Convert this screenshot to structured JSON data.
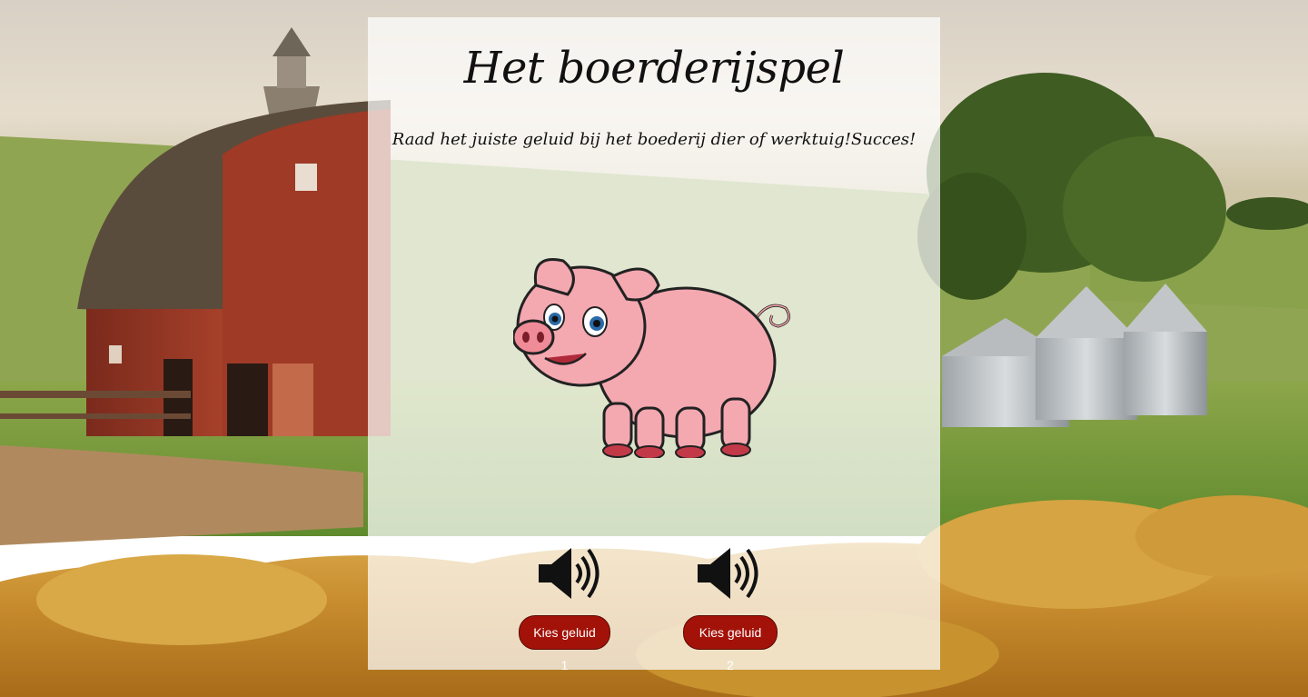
{
  "page": {
    "title": "Het boerderijspel",
    "subtitle": "Raad het juiste geluid bij het boederij dier of werktuig!Succes!"
  },
  "animal": {
    "name": "pig",
    "icon": "pig-illustration"
  },
  "sound_options": [
    {
      "icon": "speaker-icon",
      "button_label": "Kies geluid 1"
    },
    {
      "icon": "speaker-icon",
      "button_label": "Kies geluid 2"
    }
  ],
  "colors": {
    "button_bg": "#a31208",
    "panel_bg": "rgba(255,255,255,0.72)"
  }
}
